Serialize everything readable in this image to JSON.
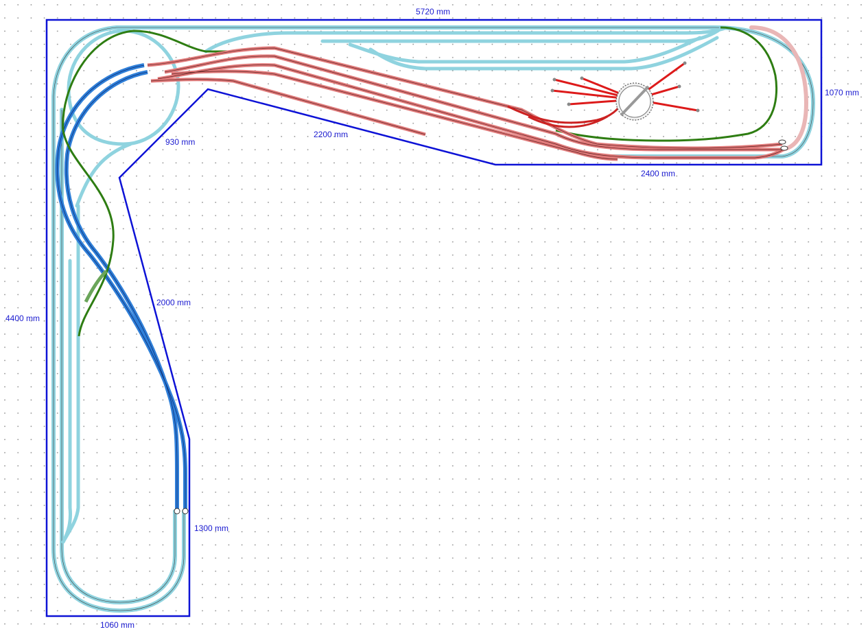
{
  "diagram": {
    "type": "model-railway-track-plan",
    "dimensions": [
      {
        "id": "top-width",
        "text": "5720 mm"
      },
      {
        "id": "right-height",
        "text": "1070 mm"
      },
      {
        "id": "bottom-right-width",
        "text": "2400 mm"
      },
      {
        "id": "diagonal-upper",
        "text": "2200 mm"
      },
      {
        "id": "inner-corner",
        "text": "930 mm"
      },
      {
        "id": "diagonal-lower",
        "text": "2000 mm"
      },
      {
        "id": "left-height",
        "text": "4400 mm"
      },
      {
        "id": "lower-right-height",
        "text": "1300 mm"
      },
      {
        "id": "bottom-width",
        "text": "1060 mm"
      }
    ],
    "colors": {
      "baseboard": "#0d12d6",
      "grid_dot": "#8a8a8a",
      "track_light_blue": "#8fd3df",
      "track_blue": "#2f7fd8",
      "track_green": "#2e7d12",
      "track_red": "#e07a7a",
      "track_bright_red": "#dd1a1a",
      "track_rail": "#3b3b3b",
      "label": "#1a1ad0"
    }
  }
}
